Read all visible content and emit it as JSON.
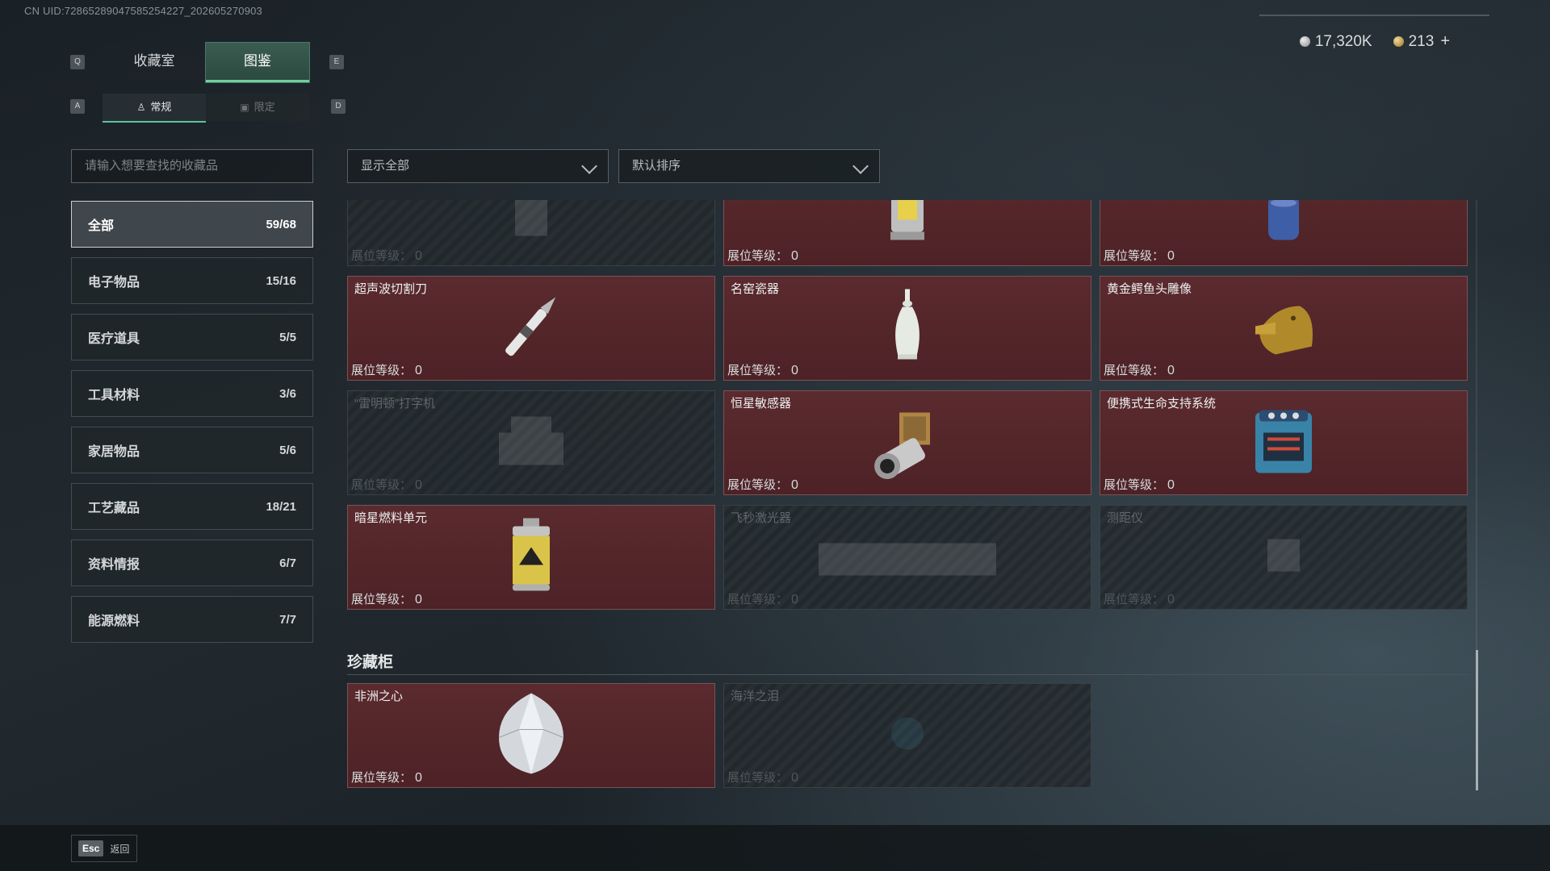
{
  "uid": "CN UID:72865289047585254227_202605270903",
  "currency": {
    "silver": "17,320K",
    "gold": "213",
    "plus": "+"
  },
  "keys": {
    "q": "Q",
    "e": "E",
    "a": "A",
    "d": "D"
  },
  "tabs": [
    {
      "label": "收藏室"
    },
    {
      "label": "图鉴"
    }
  ],
  "subtabs": [
    {
      "label": "常规"
    },
    {
      "label": "限定"
    }
  ],
  "search": {
    "placeholder": "请输入想要查找的收藏品"
  },
  "filter": {
    "value": "显示全部"
  },
  "sort": {
    "value": "默认排序"
  },
  "categories": [
    {
      "label": "全部",
      "count": "59/68"
    },
    {
      "label": "电子物品",
      "count": "15/16"
    },
    {
      "label": "医疗道具",
      "count": "5/5"
    },
    {
      "label": "工具材料",
      "count": "3/6"
    },
    {
      "label": "家居物品",
      "count": "5/6"
    },
    {
      "label": "工艺藏品",
      "count": "18/21"
    },
    {
      "label": "资料情报",
      "count": "6/7"
    },
    {
      "label": "能源燃料",
      "count": "7/7"
    }
  ],
  "level_label": "展位等级：",
  "items": [
    {
      "name": "",
      "level": "0",
      "locked": true,
      "icon": "unknown-item-icon"
    },
    {
      "name": "",
      "level": "0",
      "locked": false,
      "icon": "lantern-icon"
    },
    {
      "name": "",
      "level": "0",
      "locked": false,
      "icon": "gas-canister-icon"
    },
    {
      "name": "超声波切割刀",
      "level": "0",
      "locked": false,
      "icon": "ultrasonic-knife-icon"
    },
    {
      "name": "名窑瓷器",
      "level": "0",
      "locked": false,
      "icon": "porcelain-vase-icon"
    },
    {
      "name": "黄金鳄鱼头雕像",
      "level": "0",
      "locked": false,
      "icon": "gold-crocodile-icon"
    },
    {
      "name": "“雷明顿”打字机",
      "level": "0",
      "locked": true,
      "icon": "typewriter-icon"
    },
    {
      "name": "恒星敏感器",
      "level": "0",
      "locked": false,
      "icon": "star-sensor-icon"
    },
    {
      "name": "便携式生命支持系统",
      "level": "0",
      "locked": false,
      "icon": "life-support-icon"
    },
    {
      "name": "暗星燃料单元",
      "level": "0",
      "locked": false,
      "icon": "fuel-cell-icon"
    },
    {
      "name": "飞秒激光器",
      "level": "0",
      "locked": true,
      "icon": "laser-icon"
    },
    {
      "name": "测距仪",
      "level": "0",
      "locked": true,
      "icon": "rangefinder-icon"
    }
  ],
  "treasure_section": {
    "title": "珍藏柜"
  },
  "treasures": [
    {
      "name": "非洲之心",
      "level": "0",
      "locked": false,
      "icon": "diamond-icon"
    },
    {
      "name": "海洋之泪",
      "level": "0",
      "locked": true,
      "icon": "ocean-tear-icon"
    }
  ],
  "footer": {
    "esc_key": "Esc",
    "back_label": "返回"
  }
}
